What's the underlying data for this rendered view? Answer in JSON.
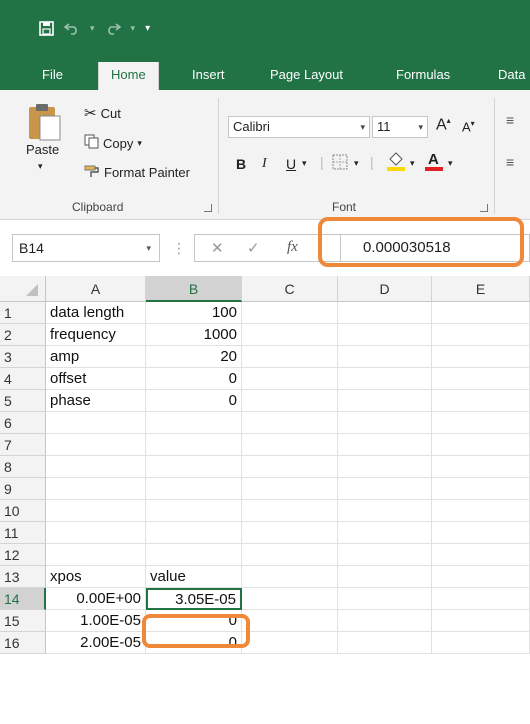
{
  "qat": {
    "save_icon": "save-icon",
    "undo_icon": "undo-icon",
    "redo_icon": "redo-icon",
    "customize_icon": "customize-qat-icon"
  },
  "tabs": [
    "File",
    "Home",
    "Insert",
    "Page Layout",
    "Formulas",
    "Data"
  ],
  "clipboard": {
    "paste_label": "Paste",
    "cut_label": "Cut",
    "copy_label": "Copy",
    "format_painter_label": "Format Painter",
    "group_label": "Clipboard"
  },
  "font": {
    "name": "Calibri",
    "size": "11",
    "bold": "B",
    "italic": "I",
    "underline": "U",
    "grow": "A",
    "shrink": "A",
    "group_label": "Font"
  },
  "formula_bar": {
    "name_box": "B14",
    "fx_label": "fx",
    "value": "0.000030518"
  },
  "grid": {
    "columns": [
      "A",
      "B",
      "C",
      "D",
      "E"
    ],
    "rows": [
      "1",
      "2",
      "3",
      "4",
      "5",
      "6",
      "7",
      "8",
      "9",
      "10",
      "11",
      "12",
      "13",
      "14",
      "15",
      "16"
    ],
    "colA": [
      "data length",
      "frequency",
      "amp",
      "offset",
      "phase",
      "",
      "",
      "",
      "",
      "",
      "",
      "",
      "xpos",
      "0.00E+00",
      "1.00E-05",
      "2.00E-05"
    ],
    "colB": [
      "100",
      "1000",
      "20",
      "0",
      "0",
      "",
      "",
      "",
      "",
      "",
      "",
      "",
      "value",
      "3.05E-05",
      "0",
      "0"
    ]
  },
  "colors": {
    "accent": "#217346",
    "highlight": "#f0883a"
  }
}
